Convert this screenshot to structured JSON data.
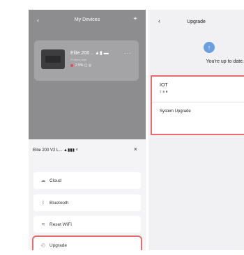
{
  "left": {
    "header": {
      "back_icon": "‹",
      "title": "My Devices",
      "add_icon": "+"
    },
    "device_card": {
      "name": "Elite 200 ..",
      "name_icons": "▲▮ ▬",
      "subtitle": "Pi demo user",
      "stats": "2  5%  ▢  ◎",
      "more": "···"
    },
    "sheet": {
      "title": "Elite 200 V2 L... ▲▮▮▮ ˅",
      "close": "×",
      "items": [
        {
          "icon": "☁",
          "label": "Cloud"
        },
        {
          "icon": "ᛒ",
          "label": "Bluetooth"
        },
        {
          "icon": "≋",
          "label": "Reset WiFi"
        },
        {
          "icon": "◴",
          "label": "Upgrade"
        }
      ]
    }
  },
  "right": {
    "header": {
      "back_icon": "‹",
      "title": "Upgrade"
    },
    "status_icon": "↑",
    "status_text": "You're up to date.",
    "iot": {
      "label": "IOT",
      "icons": "ᛒ ≋ ▮"
    },
    "system_upgrade": "System Upgrade"
  },
  "colors": {
    "highlight": "#e86a6a",
    "upgrade_icon": "#6a9fe0",
    "overlay": "#8d8d90"
  }
}
